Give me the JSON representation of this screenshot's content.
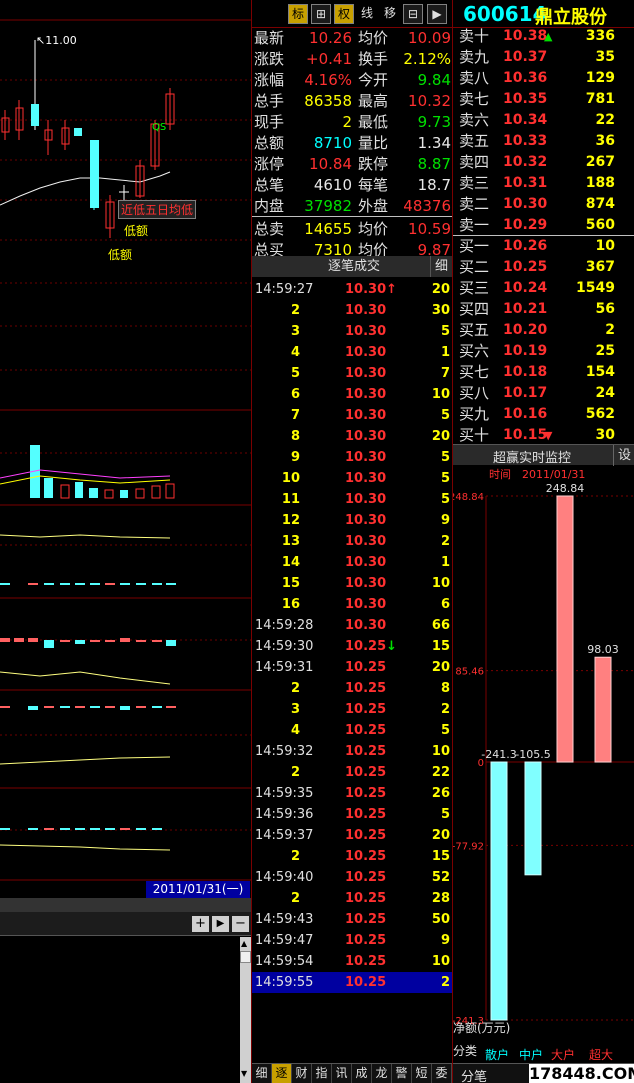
{
  "toolbar": {
    "buttons": [
      "标",
      "⊞",
      "权",
      "线",
      "移",
      "⊟",
      "▶"
    ]
  },
  "stock": {
    "code": "600614",
    "name": "鼎立股份"
  },
  "quote": [
    {
      "l1": "最新",
      "v1": "10.26",
      "c1": "red",
      "l2": "均价",
      "v2": "10.09",
      "c2": "red"
    },
    {
      "l1": "涨跌",
      "v1": "+0.41",
      "c1": "red",
      "l2": "换手",
      "v2": "2.12%",
      "c2": "yel"
    },
    {
      "l1": "涨幅",
      "v1": "4.16%",
      "c1": "red",
      "l2": "今开",
      "v2": "9.84",
      "c2": "green"
    },
    {
      "l1": "总手",
      "v1": "86358",
      "c1": "yel",
      "l2": "最高",
      "v2": "10.32",
      "c2": "red"
    },
    {
      "l1": "现手",
      "v1": "2",
      "c1": "yel",
      "l2": "最低",
      "v2": "9.73",
      "c2": "green"
    },
    {
      "l1": "总额",
      "v1": "8710",
      "c1": "cyan",
      "l2": "量比",
      "v2": "1.34",
      "c2": "white"
    },
    {
      "l1": "涨停",
      "v1": "10.84",
      "c1": "red",
      "l2": "跌停",
      "v2": "8.87",
      "c2": "green"
    },
    {
      "l1": "总笔",
      "v1": "4610",
      "c1": "white",
      "l2": "每笔",
      "v2": "18.7",
      "c2": "white"
    },
    {
      "l1": "内盘",
      "v1": "37982",
      "c1": "green",
      "l2": "外盘",
      "v2": "48376",
      "c2": "red"
    },
    {
      "l1": "总卖",
      "v1": "14655",
      "c1": "yel",
      "l2": "均价",
      "v2": "10.59",
      "c2": "red"
    },
    {
      "l1": "总买",
      "v1": "7310",
      "c1": "yel",
      "l2": "均价",
      "v2": "9.87",
      "c2": "red"
    }
  ],
  "sell": [
    {
      "l": "卖十",
      "p": "10.38",
      "v": "336",
      "arrow": "▲"
    },
    {
      "l": "卖九",
      "p": "10.37",
      "v": "35",
      "arrow": ""
    },
    {
      "l": "卖八",
      "p": "10.36",
      "v": "129",
      "arrow": ""
    },
    {
      "l": "卖七",
      "p": "10.35",
      "v": "781",
      "arrow": ""
    },
    {
      "l": "卖六",
      "p": "10.34",
      "v": "22",
      "arrow": ""
    },
    {
      "l": "卖五",
      "p": "10.33",
      "v": "36",
      "arrow": ""
    },
    {
      "l": "卖四",
      "p": "10.32",
      "v": "267",
      "arrow": ""
    },
    {
      "l": "卖三",
      "p": "10.31",
      "v": "188",
      "arrow": ""
    },
    {
      "l": "卖二",
      "p": "10.30",
      "v": "874",
      "arrow": ""
    },
    {
      "l": "卖一",
      "p": "10.29",
      "v": "560",
      "arrow": ""
    }
  ],
  "buy": [
    {
      "l": "买一",
      "p": "10.26",
      "v": "10",
      "arrow": ""
    },
    {
      "l": "买二",
      "p": "10.25",
      "v": "367",
      "arrow": ""
    },
    {
      "l": "买三",
      "p": "10.24",
      "v": "1549",
      "arrow": ""
    },
    {
      "l": "买四",
      "p": "10.21",
      "v": "56",
      "arrow": ""
    },
    {
      "l": "买五",
      "p": "10.20",
      "v": "2",
      "arrow": ""
    },
    {
      "l": "买六",
      "p": "10.19",
      "v": "25",
      "arrow": ""
    },
    {
      "l": "买七",
      "p": "10.18",
      "v": "154",
      "arrow": ""
    },
    {
      "l": "买八",
      "p": "10.17",
      "v": "24",
      "arrow": ""
    },
    {
      "l": "买九",
      "p": "10.16",
      "v": "562",
      "arrow": ""
    },
    {
      "l": "买十",
      "p": "10.15",
      "v": "30",
      "arrow": "▼"
    }
  ],
  "ticks_header": {
    "title": "逐笔成交",
    "btn": "细"
  },
  "ticks": [
    {
      "t": "14:59:27",
      "n": "",
      "p": "10.30",
      "v": "20",
      "a": "↑"
    },
    {
      "t": "",
      "n": "2",
      "p": "10.30",
      "v": "30",
      "a": ""
    },
    {
      "t": "",
      "n": "3",
      "p": "10.30",
      "v": "5",
      "a": ""
    },
    {
      "t": "",
      "n": "4",
      "p": "10.30",
      "v": "1",
      "a": ""
    },
    {
      "t": "",
      "n": "5",
      "p": "10.30",
      "v": "7",
      "a": ""
    },
    {
      "t": "",
      "n": "6",
      "p": "10.30",
      "v": "10",
      "a": ""
    },
    {
      "t": "",
      "n": "7",
      "p": "10.30",
      "v": "5",
      "a": ""
    },
    {
      "t": "",
      "n": "8",
      "p": "10.30",
      "v": "20",
      "a": ""
    },
    {
      "t": "",
      "n": "9",
      "p": "10.30",
      "v": "5",
      "a": ""
    },
    {
      "t": "",
      "n": "10",
      "p": "10.30",
      "v": "5",
      "a": ""
    },
    {
      "t": "",
      "n": "11",
      "p": "10.30",
      "v": "5",
      "a": ""
    },
    {
      "t": "",
      "n": "12",
      "p": "10.30",
      "v": "9",
      "a": ""
    },
    {
      "t": "",
      "n": "13",
      "p": "10.30",
      "v": "2",
      "a": ""
    },
    {
      "t": "",
      "n": "14",
      "p": "10.30",
      "v": "1",
      "a": ""
    },
    {
      "t": "",
      "n": "15",
      "p": "10.30",
      "v": "10",
      "a": ""
    },
    {
      "t": "",
      "n": "16",
      "p": "10.30",
      "v": "6",
      "a": ""
    },
    {
      "t": "14:59:28",
      "n": "",
      "p": "10.30",
      "v": "66",
      "a": ""
    },
    {
      "t": "14:59:30",
      "n": "",
      "p": "10.25",
      "v": "15",
      "a": "↓"
    },
    {
      "t": "14:59:31",
      "n": "",
      "p": "10.25",
      "v": "20",
      "a": ""
    },
    {
      "t": "",
      "n": "2",
      "p": "10.25",
      "v": "8",
      "a": ""
    },
    {
      "t": "",
      "n": "3",
      "p": "10.25",
      "v": "2",
      "a": ""
    },
    {
      "t": "",
      "n": "4",
      "p": "10.25",
      "v": "5",
      "a": ""
    },
    {
      "t": "14:59:32",
      "n": "",
      "p": "10.25",
      "v": "10",
      "a": ""
    },
    {
      "t": "",
      "n": "2",
      "p": "10.25",
      "v": "22",
      "a": ""
    },
    {
      "t": "14:59:35",
      "n": "",
      "p": "10.25",
      "v": "26",
      "a": ""
    },
    {
      "t": "14:59:36",
      "n": "",
      "p": "10.25",
      "v": "5",
      "a": ""
    },
    {
      "t": "14:59:37",
      "n": "",
      "p": "10.25",
      "v": "20",
      "a": ""
    },
    {
      "t": "",
      "n": "2",
      "p": "10.25",
      "v": "15",
      "a": ""
    },
    {
      "t": "14:59:40",
      "n": "",
      "p": "10.25",
      "v": "52",
      "a": ""
    },
    {
      "t": "",
      "n": "2",
      "p": "10.25",
      "v": "28",
      "a": ""
    },
    {
      "t": "14:59:43",
      "n": "",
      "p": "10.25",
      "v": "50",
      "a": ""
    },
    {
      "t": "14:59:47",
      "n": "",
      "p": "10.25",
      "v": "9",
      "a": ""
    },
    {
      "t": "14:59:54",
      "n": "",
      "p": "10.25",
      "v": "10",
      "a": ""
    },
    {
      "t": "14:59:55",
      "n": "",
      "p": "10.25",
      "v": "2",
      "a": ""
    }
  ],
  "monitor": {
    "title": "超赢实时监控",
    "settings": "设",
    "time_label": "时间",
    "date": "2011/01/31",
    "axis": [
      "248.84",
      "85.46",
      "0",
      "-77.92",
      "-241.3"
    ],
    "ylabel": "净额(万元)",
    "xlabel": "分类",
    "cats": [
      "散户",
      "中户",
      "大户",
      "超大"
    ],
    "values": [
      -241.3,
      -105.5,
      248.84,
      98.03
    ],
    "value_labels": [
      "-241.3",
      "-105.5",
      "248.84",
      "98.03"
    ]
  },
  "kline": {
    "high_label": "11.00",
    "annotations": [
      "近低五日均低",
      "低额",
      "低额",
      "QS"
    ],
    "date_label": "2011/01/31(一)"
  },
  "bottom_tabs": [
    "细",
    "逐",
    "财",
    "指",
    "讯",
    "成",
    "龙",
    "警",
    "短",
    "委"
  ],
  "bottom_right": [
    "分笔"
  ],
  "watermark": "178448.COM"
}
